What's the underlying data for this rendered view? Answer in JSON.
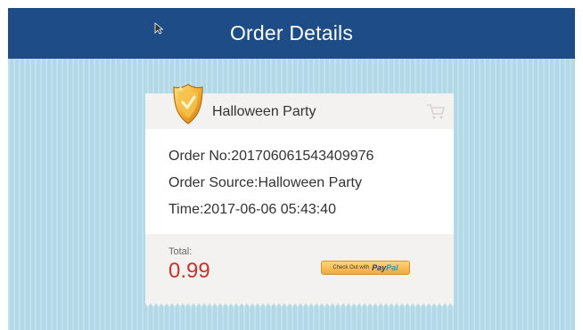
{
  "header": {
    "title": "Order Details"
  },
  "order": {
    "name": "Halloween Party",
    "order_no": "Order No:201706061543409976",
    "order_source": "Order Source:Halloween Party",
    "time": "Time:2017-06-06 05:43:40",
    "total_label": "Total:",
    "total_value": "0.99"
  },
  "checkout": {
    "prefix": "Check Out with",
    "brand_pay": "Pay",
    "brand_pal": "Pal"
  },
  "icons": {
    "badge": "shield-badge-icon",
    "cart": "shopping-cart-icon",
    "cursor": "mouse-cursor-icon"
  },
  "colors": {
    "header_bg": "#1d4c86",
    "screen_bg": "#b2d9e8",
    "total_value": "#c9332b",
    "paypal_button": "#f1a93b"
  }
}
